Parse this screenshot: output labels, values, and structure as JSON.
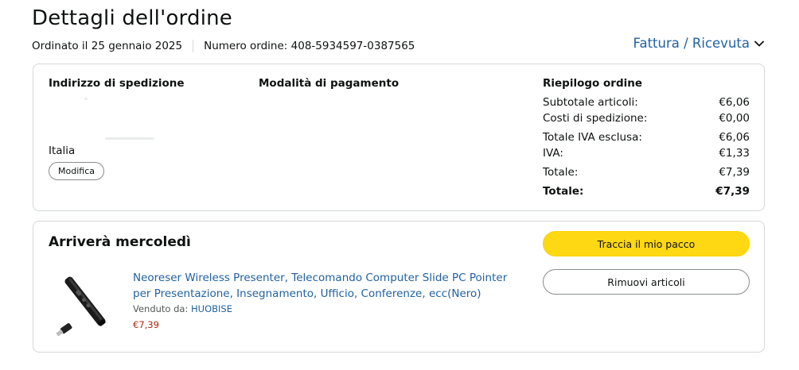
{
  "page": {
    "title": "Dettagli dell'ordine",
    "order_date": "Ordinato il 25 gennaio 2025",
    "order_number": "Numero ordine: 408-5934597-0387565",
    "invoice_link": "Fattura / Ricevuta"
  },
  "summary": {
    "shipping_heading": "Indirizzo di spedizione",
    "country": "Italia",
    "edit_button": "Modifica",
    "payment_heading": "Modalità di pagamento",
    "order_summary_heading": "Riepilogo ordine",
    "rows": [
      {
        "label": "Subtotale articoli:",
        "value": "€6,06"
      },
      {
        "label": "Costi di spedizione:",
        "value": "€0,00"
      },
      {
        "label": "Totale IVA esclusa:",
        "value": "€6,06"
      },
      {
        "label": "IVA:",
        "value": "€1,33"
      },
      {
        "label": "Totale:",
        "value": "€7,39"
      },
      {
        "label": "Totale:",
        "value": "€7,39"
      }
    ]
  },
  "shipment": {
    "arrival": "Arriverà mercoledì",
    "product_title": "Neoreser Wireless Presenter, Telecomando Computer Slide PC Pointer per Presentazione, Insegnamento, Ufficio, Conferenze, ecc(Nero)",
    "sold_by_label": "Venduto da:",
    "seller": "HUOBISE",
    "price": "€7,39",
    "track_button": "Traccia il mio pacco",
    "remove_button": "Rimuovi articoli"
  },
  "colors": {
    "link": "#2162a1",
    "price": "#b12704",
    "primary_button": "#ffd814",
    "border": "#d5d9d9"
  },
  "icons": {
    "invoice_dropdown": "chevron-down-icon",
    "product_image": "wireless-presenter-image"
  }
}
